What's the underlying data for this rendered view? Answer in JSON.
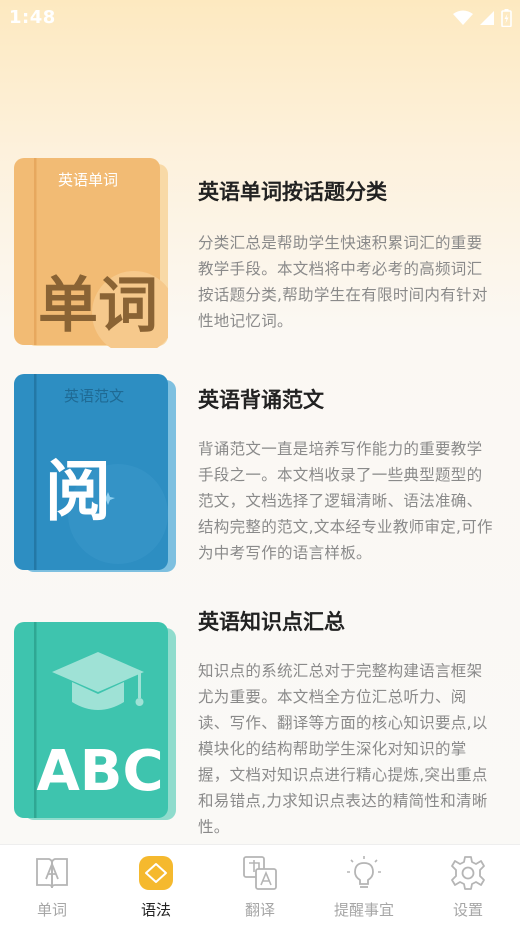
{
  "status": {
    "time": "1:48"
  },
  "cards": [
    {
      "title": "英语单词按话题分类",
      "description": "分类汇总是帮助学生快速积累词汇的重要教学手段。本文档将中考必考的高频词汇按话题分类,帮助学生在有限时间内有针对性地记忆词。",
      "cover_caption": "英语单词",
      "cover_text": "单词"
    },
    {
      "title": "英语背诵范文",
      "description": "背诵范文一直是培养写作能力的重要教学手段之一。本文档收录了一些典型题型的范文，文档选择了逻辑清晰、语法准确、结构完整的范文,文本经专业教师审定,可作为中考写作的语言样板。",
      "cover_caption": "英语范文",
      "cover_text": "阅"
    },
    {
      "title": "英语知识点汇总",
      "description": "知识点的系统汇总对于完整构建语言框架尤为重要。本文档全方位汇总听力、阅读、写作、翻译等方面的核心知识要点,以模块化的结构帮助学生深化对知识的掌握，文档对知识点进行精心提炼,突出重点和易错点,力求知识点表达的精简性和清晰性。",
      "cover_text": "ABC"
    }
  ],
  "tabs": [
    {
      "label": "单词",
      "icon": "book-icon",
      "active": false
    },
    {
      "label": "语法",
      "icon": "tag-icon",
      "active": true
    },
    {
      "label": "翻译",
      "icon": "translate-icon",
      "active": false
    },
    {
      "label": "提醒事宜",
      "icon": "lightbulb-icon",
      "active": false
    },
    {
      "label": "设置",
      "icon": "gear-icon",
      "active": false
    }
  ],
  "colors": {
    "accent": "#f5b92e",
    "book_orange": "#f2bb74",
    "book_blue": "#2d8ec2",
    "book_teal": "#3ec4ae"
  }
}
